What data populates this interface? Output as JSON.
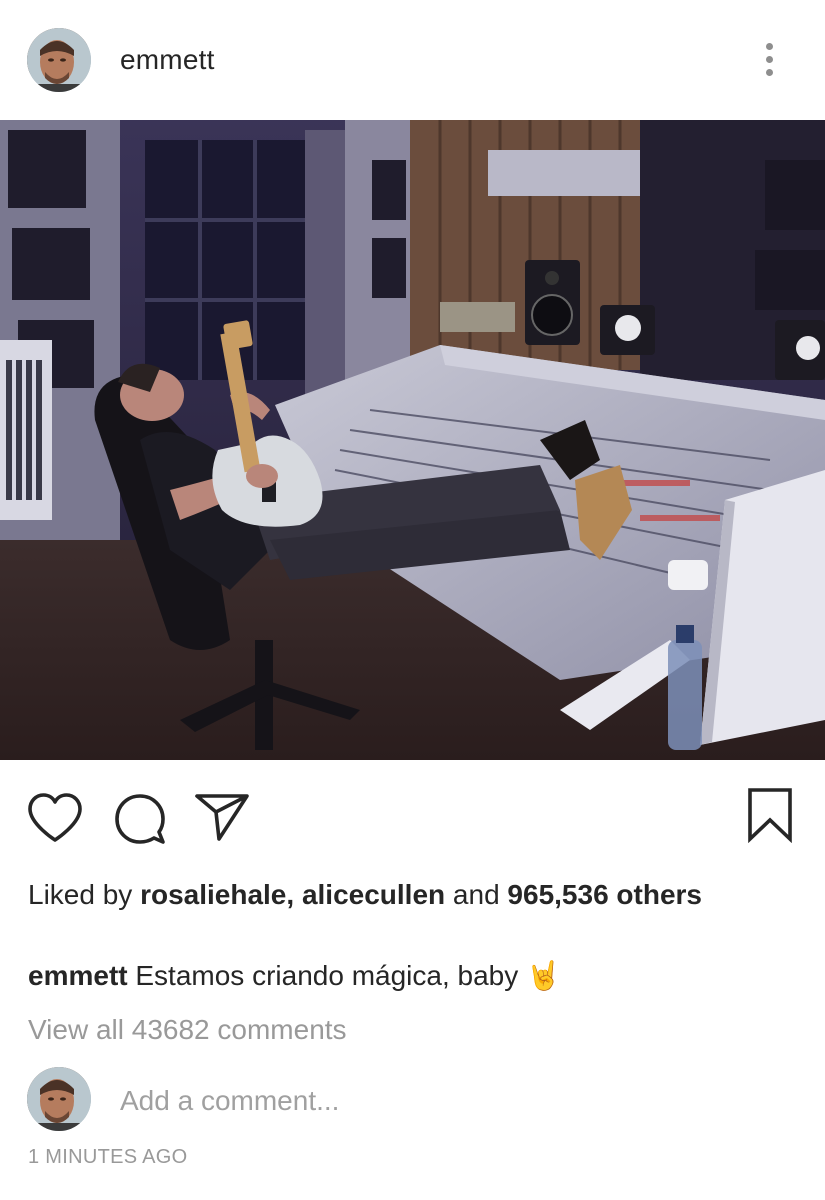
{
  "post": {
    "username": "emmett",
    "more_icon": "more-vertical-icon",
    "photo_icon": "studio-photo"
  },
  "actions": {
    "like_icon": "heart-icon",
    "comment_icon": "comment-icon",
    "share_icon": "send-icon",
    "save_icon": "bookmark-icon"
  },
  "likes": {
    "prefix": "Liked by ",
    "user1": "rosaliehale",
    "separator": ", ",
    "user2": "alicecullen",
    "conjunction": " and ",
    "count_text": "965,536 others"
  },
  "caption": {
    "username": "emmett",
    "text": "Estamos criando mágica, baby",
    "emoji": "🤘"
  },
  "comments": {
    "view_all": "View all 43682 comments",
    "placeholder": "Add a comment..."
  },
  "timestamp": "1 MINUTES AGO",
  "colors": {
    "text": "#262626",
    "muted": "#999999",
    "icon": "#262626"
  }
}
